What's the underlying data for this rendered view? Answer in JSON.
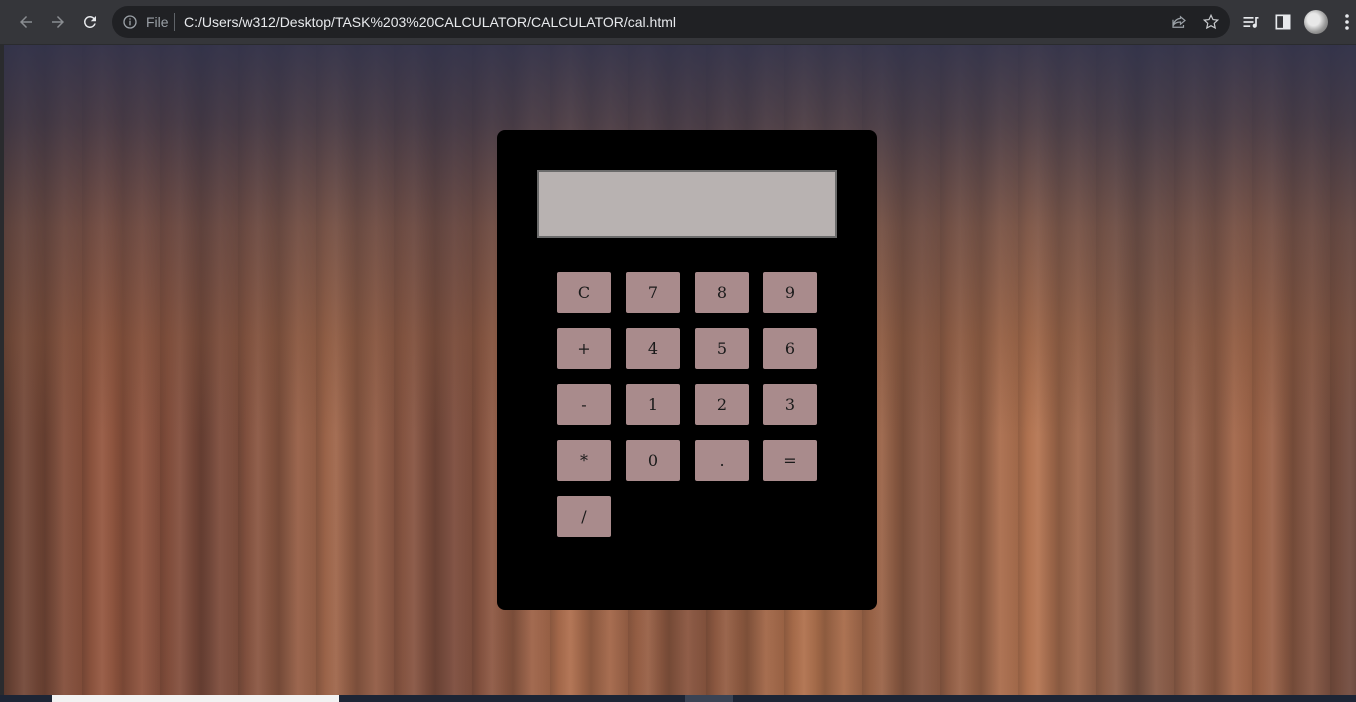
{
  "browser": {
    "file_label": "File",
    "url": "C:/Users/w312/Desktop/TASK%203%20CALCULATOR/CALCULATOR/cal.html"
  },
  "calculator": {
    "display_value": "",
    "keys": [
      [
        "C",
        "7",
        "8",
        "9"
      ],
      [
        "+",
        "4",
        "5",
        "6"
      ],
      [
        "-",
        "1",
        "2",
        "3"
      ],
      [
        "*",
        "0",
        ".",
        "="
      ],
      [
        "/"
      ]
    ]
  },
  "colors": {
    "calculator_body": "#000000",
    "display": "#b8b2b1",
    "key": "#a98b8c",
    "chrome_toolbar": "#35363a",
    "omnibox": "#202124"
  },
  "icons": [
    "back-arrow-icon",
    "forward-arrow-icon",
    "reload-icon",
    "info-icon",
    "share-icon",
    "star-icon",
    "reading-list-icon",
    "side-panel-icon",
    "profile-avatar",
    "more-menu-icon"
  ]
}
